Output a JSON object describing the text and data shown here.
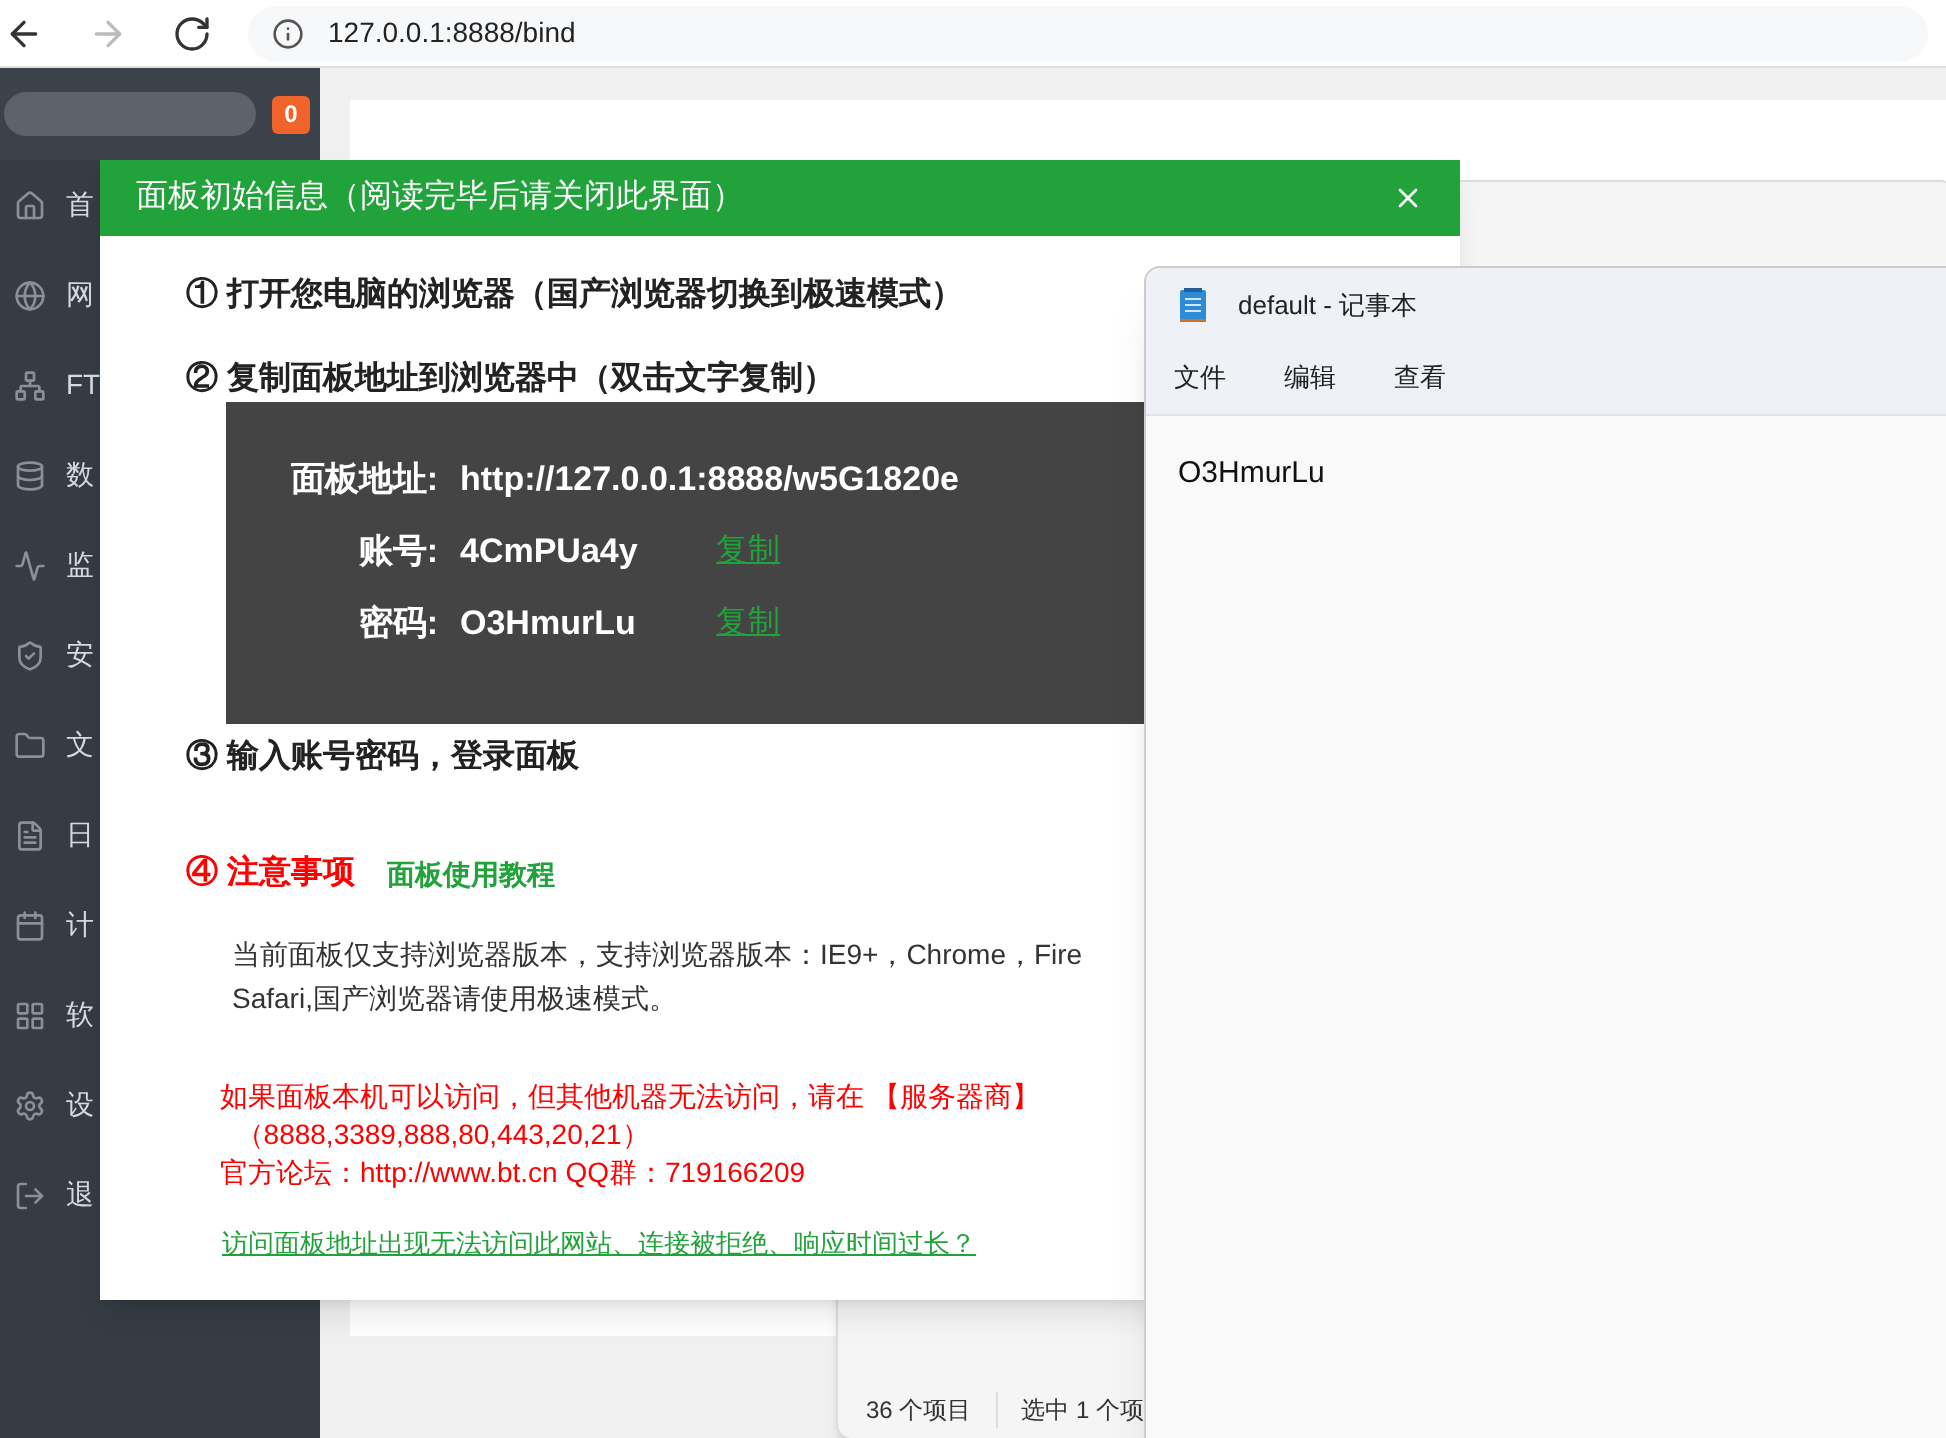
{
  "browser": {
    "url": "127.0.0.1:8888/bind",
    "forward_enabled": false
  },
  "sidebar": {
    "badge": "0",
    "items": [
      {
        "kind": "home",
        "label": "首"
      },
      {
        "kind": "globe",
        "label": "网"
      },
      {
        "kind": "ftp",
        "label": "FT"
      },
      {
        "kind": "database",
        "label": "数"
      },
      {
        "kind": "monitor",
        "label": "监"
      },
      {
        "kind": "shield",
        "label": "安"
      },
      {
        "kind": "folder",
        "label": "文"
      },
      {
        "kind": "log",
        "label": "日"
      },
      {
        "kind": "calendar",
        "label": "计"
      },
      {
        "kind": "apps",
        "label": "软"
      },
      {
        "kind": "settings",
        "label": "设"
      },
      {
        "kind": "logout",
        "label": "退"
      }
    ]
  },
  "explorer": {
    "status": [
      "36 个项目",
      "选中 1 个项"
    ]
  },
  "dialog": {
    "title": "面板初始信息（阅读完毕后请关闭此界面）",
    "steps": [
      {
        "number": "①",
        "text": "打开您电脑的浏览器（国产浏览器切换到极速模式）"
      },
      {
        "number": "②",
        "text": "复制面板地址到浏览器中（双击文字复制）"
      }
    ],
    "credentials": [
      {
        "label": "面板地址:",
        "value": "http://127.0.0.1:8888/w5G1820e"
      },
      {
        "label": "账号:",
        "value": "4CmPUa4y",
        "action": "复制"
      },
      {
        "label": "密码:",
        "value": "O3HmurLu",
        "action": "复制"
      }
    ],
    "step3": {
      "number": "③",
      "text": "输入账号密码，登录面板"
    },
    "notice": {
      "number": "④",
      "title": "注意事项",
      "tutorial_link": "面板使用教程",
      "browser_note": [
        "当前面板仅支持浏览器版本，支持浏览器版本：IE9+，Chrome，Fire",
        "Safari,国产浏览器请使用极速模式。"
      ],
      "warning": [
        "如果面板本机可以访问，但其他机器无法访问，请在 【服务器商】",
        "（8888,3389,888,80,443,20,21）",
        "官方论坛：http://www.bt.cn  QQ群：719166209"
      ],
      "help_link": "访问面板地址出现无法访问此网站、连接被拒绝、响应时间过长？"
    }
  },
  "notepad": {
    "title": "default - 记事本",
    "menu": [
      "文件",
      "编辑",
      "查看"
    ],
    "content": "O3HmurLu"
  }
}
